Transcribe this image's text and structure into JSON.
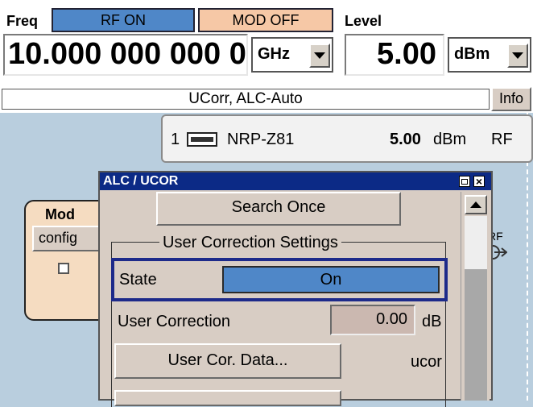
{
  "header": {
    "freq_label": "Freq",
    "rf_status": "RF ON",
    "mod_status": "MOD OFF",
    "level_label": "Level",
    "freq_value": "10.000 000 000 0",
    "freq_unit": "GHz",
    "level_value": "5.00",
    "level_unit": "dBm",
    "info_text": "UCorr, ALC-Auto",
    "info_button": "Info"
  },
  "sensor": {
    "channel": "1",
    "name": "NRP-Z81",
    "value": "5.00",
    "unit": "dBm",
    "tag": "RF"
  },
  "background_block": {
    "title": "Mod",
    "config_label": "config",
    "rf_label": "RF"
  },
  "dialog": {
    "title": "ALC / UCOR",
    "search_once": "Search Once",
    "group_title": "User Correction Settings",
    "state_label": "State",
    "state_value": "On",
    "user_correction_label": "User Correction",
    "user_correction_value": "0.00",
    "user_correction_unit": "dB",
    "user_cor_data_button": "User Cor. Data...",
    "ucor_file": "ucor"
  },
  "colors": {
    "rf_on_bg": "#4f87c8",
    "mod_off_bg": "#f6c8a6",
    "dialog_title_bg": "#0c2a86",
    "dialog_bg": "#d8cdc4",
    "desktop_bg": "#b9cede",
    "mod_block_bg": "#f5dcc1"
  }
}
